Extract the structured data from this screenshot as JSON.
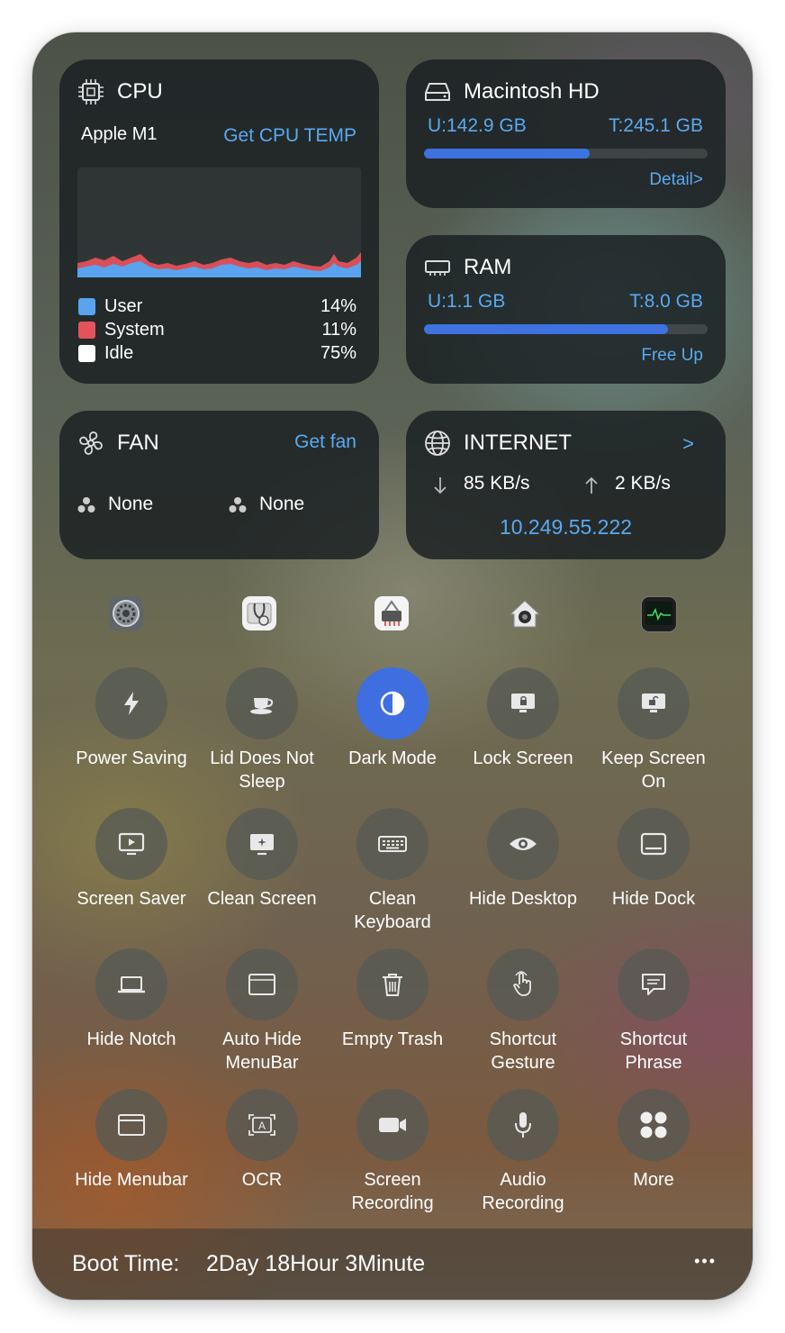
{
  "cpu": {
    "title": "CPU",
    "model": "Apple M1",
    "action": "Get CPU TEMP",
    "legend": [
      {
        "label": "User",
        "value": "14%",
        "color": "#5aa3ef"
      },
      {
        "label": "System",
        "value": "11%",
        "color": "#e4525a"
      },
      {
        "label": "Idle",
        "value": "75%",
        "color": "#ffffff"
      }
    ]
  },
  "disk": {
    "title": "Macintosh HD",
    "used": "U:142.9 GB",
    "total": "T:245.1 GB",
    "usage_fraction": 0.583,
    "action": "Detail>"
  },
  "ram": {
    "title": "RAM",
    "used": "U:1.1 GB",
    "total": "T:8.0 GB",
    "usage_fraction": 0.86,
    "action": "Free Up"
  },
  "fan": {
    "title": "FAN",
    "action": "Get fan",
    "fans": [
      "None",
      "None"
    ]
  },
  "internet": {
    "title": "INTERNET",
    "more": ">",
    "download": "85 KB/s",
    "upload": "2 KB/s",
    "ip": "10.249.55.222"
  },
  "apps": [
    {
      "icon": "system-settings-icon"
    },
    {
      "icon": "disk-utility-icon"
    },
    {
      "icon": "network-utility-icon"
    },
    {
      "icon": "home-app-icon"
    },
    {
      "icon": "activity-monitor-icon"
    }
  ],
  "buttons": [
    {
      "label": "Power Saving",
      "icon": "bolt-icon"
    },
    {
      "label": "Lid Does Not Sleep",
      "icon": "cup-icon"
    },
    {
      "label": "Dark Mode",
      "icon": "contrast-icon",
      "active": true
    },
    {
      "label": "Lock Screen",
      "icon": "lock-display-icon"
    },
    {
      "label": "Keep Screen On",
      "icon": "unlock-display-icon"
    },
    {
      "label": "Screen Saver",
      "icon": "screen-play-icon"
    },
    {
      "label": "Clean Screen",
      "icon": "sparkle-display-icon"
    },
    {
      "label": "Clean Keyboard",
      "icon": "keyboard-icon"
    },
    {
      "label": "Hide Desktop",
      "icon": "eye-icon"
    },
    {
      "label": "Hide Dock",
      "icon": "dock-icon"
    },
    {
      "label": "Hide Notch",
      "icon": "laptop-icon"
    },
    {
      "label": "Auto Hide MenuBar",
      "icon": "window-icon"
    },
    {
      "label": "Empty Trash",
      "icon": "trash-icon"
    },
    {
      "label": "Shortcut Gesture",
      "icon": "hand-pointer-icon"
    },
    {
      "label": "Shortcut Phrase",
      "icon": "speech-bubble-icon"
    },
    {
      "label": "Hide Menubar",
      "icon": "menubar-icon"
    },
    {
      "label": "OCR",
      "icon": "text-scan-icon"
    },
    {
      "label": "Screen Recording",
      "icon": "video-camera-icon"
    },
    {
      "label": "Audio Recording",
      "icon": "microphone-icon"
    },
    {
      "label": "More",
      "icon": "grid-dots-icon"
    }
  ],
  "footer": {
    "label": "Boot Time:",
    "value": "2Day 18Hour 3Minute",
    "menu": "•••"
  }
}
